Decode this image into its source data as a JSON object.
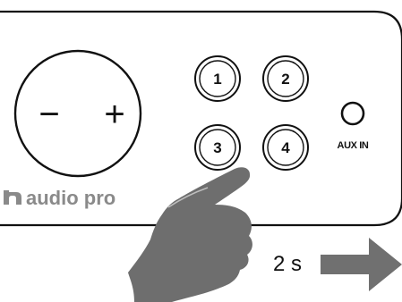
{
  "device": {
    "brand_name": "audio pro",
    "colors": {
      "line": "#111111",
      "brand_gray": "#8a8a8a",
      "hand": "#6e6e6e",
      "arrow": "#707070",
      "background": "#ffffff"
    }
  },
  "volume_wheel": {
    "minus_label": "−",
    "plus_label": "+"
  },
  "presets": [
    {
      "label": "1"
    },
    {
      "label": "2"
    },
    {
      "label": "3"
    },
    {
      "label": "4"
    }
  ],
  "aux": {
    "label": "AUX IN"
  },
  "instruction": {
    "duration_label": "2 s",
    "pressed_preset": "4",
    "arrow_direction": "right"
  }
}
